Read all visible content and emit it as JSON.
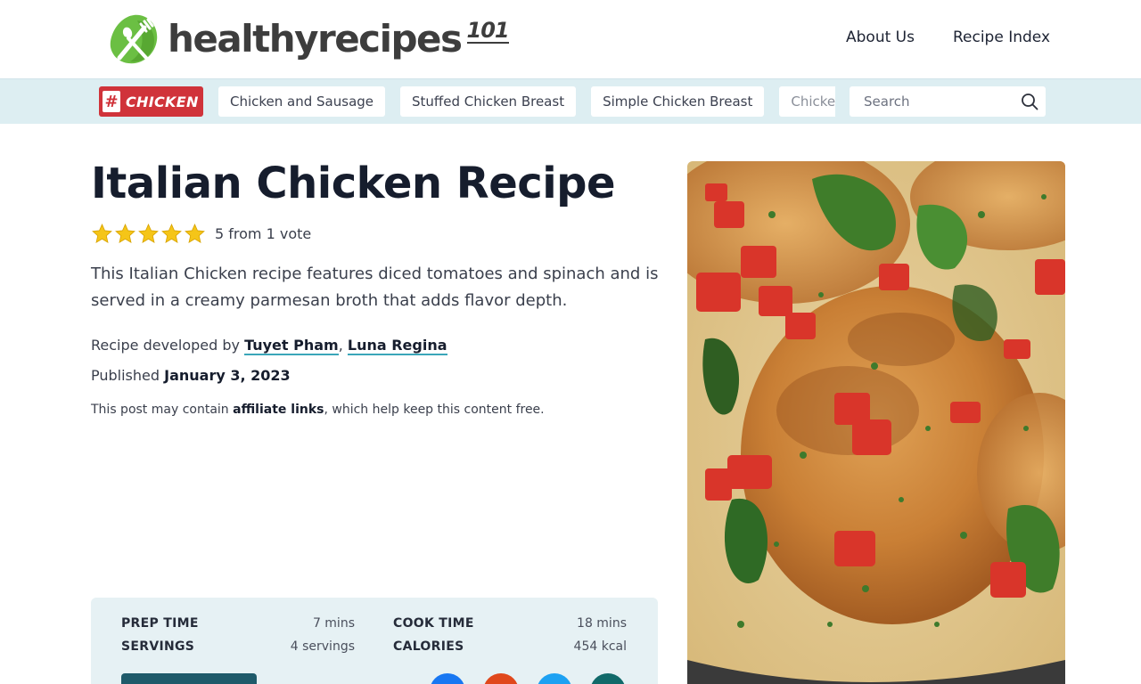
{
  "header": {
    "logo_text": "healthyrecipes",
    "logo_sup": "101",
    "nav": [
      {
        "label": "About Us"
      },
      {
        "label": "Recipe Index"
      }
    ]
  },
  "category_bar": {
    "tag_hash": "#",
    "tag_label": "CHICKEN",
    "chips": [
      {
        "label": "Chicken and Sausage"
      },
      {
        "label": "Stuffed Chicken Breast"
      },
      {
        "label": "Simple Chicken Breast"
      },
      {
        "label": "Chicken an"
      }
    ],
    "search_placeholder": "Search"
  },
  "recipe": {
    "title": "Italian Chicken Recipe",
    "stars": 5,
    "rating_text": "5 from 1 vote",
    "summary": "This Italian Chicken recipe features diced tomatoes and spinach and is served in a creamy parmesan broth that adds flavor depth.",
    "byline_prefix": "Recipe developed by ",
    "authors": [
      "Tuyet Pham",
      "Luna Regina"
    ],
    "byline_sep": ", ",
    "published_prefix": "Published ",
    "published_date": "January 3, 2023",
    "disclaimer_pre": "This post may contain ",
    "disclaimer_bold": "affiliate links",
    "disclaimer_post": ", which help keep this content free."
  },
  "meta": {
    "prep_label": "PREP TIME",
    "prep_value": "7 mins",
    "cook_label": "COOK TIME",
    "cook_value": "18 mins",
    "servings_label": "SERVINGS",
    "servings_value": "4 servings",
    "calories_label": "CALORIES",
    "calories_value": "454 kcal"
  },
  "colors": {
    "brand_green": "#6bbf43",
    "tag_red": "#d0333a",
    "bar_bg": "#ddeef2",
    "link_underline": "#3aa6b9",
    "star": "#f5c518",
    "share_facebook": "#1877f2",
    "share_reddit": "#e0481c",
    "share_twitter": "#1da1f2",
    "share_other": "#116a6a"
  }
}
